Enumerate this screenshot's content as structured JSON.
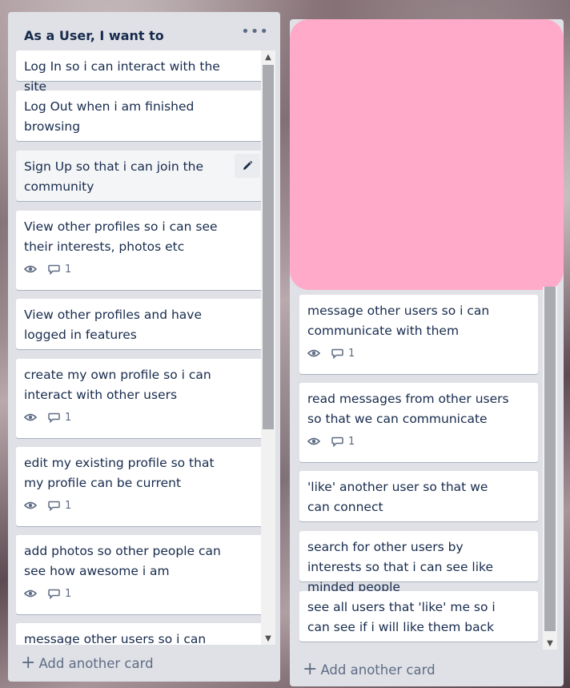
{
  "colors": {
    "list_bg": "#dfe1e6",
    "card_bg": "#ffffff",
    "cover": "#ffaac8",
    "muted_text": "#5e6c84"
  },
  "left_list": {
    "title": "As a User, I want to",
    "menu_icon": "ellipsis-icon",
    "cards": [
      {
        "title": "Log In so i can interact with the site"
      },
      {
        "title": "Log Out when i am finished browsing"
      },
      {
        "title": "Sign Up so that i can join the community",
        "hover": true,
        "edit_icon": "pencil-icon"
      },
      {
        "title": "View other profiles so i can see their interests, photos etc",
        "comments": "1"
      },
      {
        "title": "View other profiles and have logged in features"
      },
      {
        "title": "create my own profile so i can interact with other users",
        "comments": "1"
      },
      {
        "title": "edit my existing profile so that my profile can be current",
        "comments": "1"
      },
      {
        "title": "add photos so other people can see how awesome i am",
        "comments": "1"
      },
      {
        "title": "message other users so i can communicate with them"
      }
    ],
    "add_card": "Add another card"
  },
  "right_list": {
    "cover_color": "#ffaac8",
    "cards": [
      {
        "title": "message other users so i can communicate with them",
        "comments": "1"
      },
      {
        "title": "read messages from other users so that we can communicate",
        "comments": "1"
      },
      {
        "title": "'like' another user so that we can connect"
      },
      {
        "title": "search for other users by interests so that i can see like minded people"
      },
      {
        "title": "see all users that 'like' me so i can see if i will like them back"
      }
    ],
    "add_card": "Add another card"
  }
}
